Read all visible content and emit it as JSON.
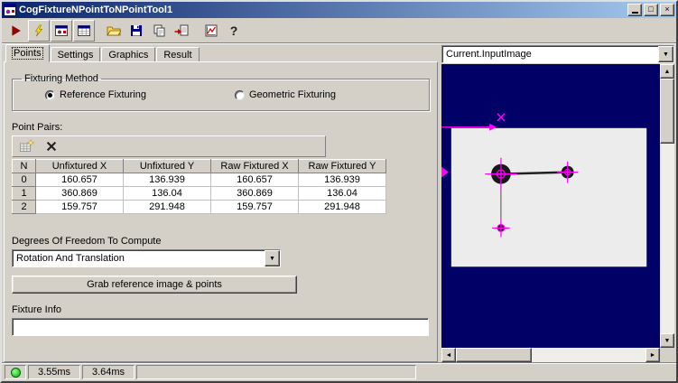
{
  "window": {
    "title": "CogFixtureNPointToNPointTool1",
    "maximize_glyph": "□",
    "close_glyph": "×"
  },
  "tabs": [
    "Points",
    "Settings",
    "Graphics",
    "Result"
  ],
  "fixturing_method": {
    "legend": "Fixturing Method",
    "option1": "Reference Fixturing",
    "option2": "Geometric Fixturing",
    "selected": "Reference Fixturing"
  },
  "point_pairs": {
    "label": "Point Pairs:",
    "columns": [
      "N",
      "Unfixtured X",
      "Unfixtured Y",
      "Raw Fixtured X",
      "Raw Fixtured Y"
    ],
    "rows": [
      [
        "0",
        "160.657",
        "136.939",
        "160.657",
        "136.939"
      ],
      [
        "1",
        "360.869",
        "136.04",
        "360.869",
        "136.04"
      ],
      [
        "2",
        "159.757",
        "291.948",
        "159.757",
        "291.948"
      ]
    ]
  },
  "dof": {
    "label": "Degrees Of Freedom To Compute",
    "value": "Rotation And Translation"
  },
  "grab_button_label": "Grab reference image & points",
  "fixture_info": {
    "label": "Fixture Info",
    "value": ""
  },
  "image_panel": {
    "selected_source": "Current.InputImage",
    "background_color": "#000066",
    "overlay_color": "#ff00ff"
  },
  "status_bar": {
    "time1": "3.55ms",
    "time2": "3.64ms"
  },
  "icons": {
    "dropdown": "▼",
    "scroll_up": "▲",
    "scroll_down": "▼",
    "scroll_left": "◄",
    "scroll_right": "►"
  }
}
